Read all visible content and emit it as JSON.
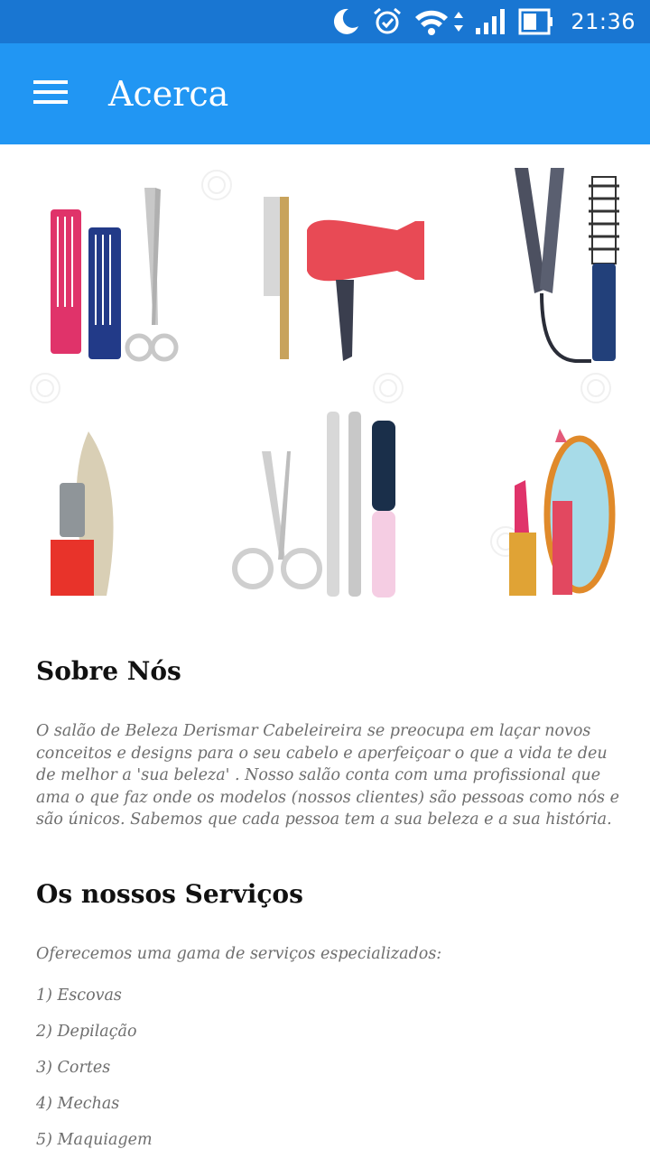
{
  "status_bar": {
    "time": "21:36",
    "icons": [
      "moon-icon",
      "alarm-icon",
      "wifi-icon",
      "signal-icon",
      "battery-icon"
    ]
  },
  "app_bar": {
    "menu_icon": "hamburger-menu-icon",
    "title": "Acerca"
  },
  "banner": {
    "items": [
      "combs-and-scissors",
      "hair-dryer",
      "hair-straightener",
      "nail-polish",
      "manicure-tools",
      "lipstick-and-mirror"
    ]
  },
  "about": {
    "heading": "Sobre Nós",
    "text": "O salão de Beleza Derismar Cabeleireira  se preocupa em laçar novos conceitos e designs para o seu cabelo e aperfeiçoar o que a vida te deu de melhor a 'sua beleza' . Nosso salão conta com uma profissional que ama o que faz onde os modelos (nossos clientes) são pessoas como nós e são únicos. Sabemos que cada pessoa tem a sua beleza e a sua história."
  },
  "services": {
    "heading": "Os nossos Serviços",
    "intro": "Oferecemos uma gama de serviços especializados:",
    "items": [
      "1) Escovas",
      "2) Depilação",
      "3) Cortes",
      "4) Mechas",
      "5) Maquiagem"
    ]
  },
  "colors": {
    "status_bar": "#1976d2",
    "app_bar": "#2196f3",
    "body_text": "#6e6e6e",
    "heading": "#111111"
  }
}
